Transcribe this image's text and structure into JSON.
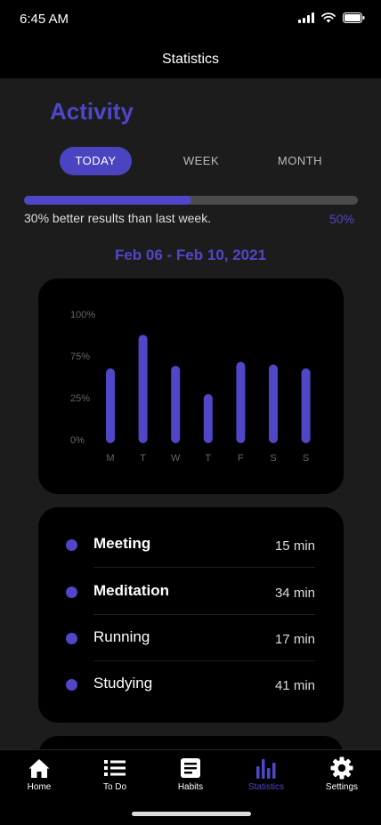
{
  "status_bar": {
    "time": "6:45 AM"
  },
  "header": {
    "title": "Statistics"
  },
  "activity": {
    "title": "Activity",
    "segments": [
      {
        "label": "TODAY",
        "active": true
      },
      {
        "label": "WEEK",
        "active": false
      },
      {
        "label": "MONTH",
        "active": false
      }
    ],
    "progress": {
      "fraction": 0.5,
      "value_label": "50%",
      "caption": "30% better results than last week."
    },
    "date_range": "Feb 06 - Feb 10, 2021"
  },
  "chart_data": {
    "type": "bar",
    "categories": [
      "M",
      "T",
      "W",
      "T",
      "F",
      "S",
      "S"
    ],
    "values": [
      58,
      84,
      60,
      38,
      63,
      61,
      58
    ],
    "yticks": [
      "100%",
      "75%",
      "25%",
      "0%"
    ],
    "ylim": [
      0,
      100
    ],
    "bar_color": "#5046c8",
    "grid": false
  },
  "activities": [
    {
      "name": "Meeting",
      "duration": "15 min",
      "bold": true
    },
    {
      "name": "Meditation",
      "duration": "34 min",
      "bold": true
    },
    {
      "name": "Running",
      "duration": "17 min",
      "bold": false
    },
    {
      "name": "Studying",
      "duration": "41 min",
      "bold": false
    }
  ],
  "tab_bar": {
    "items": [
      {
        "label": "Home",
        "icon": "home-icon",
        "active": false
      },
      {
        "label": "To Do",
        "icon": "list-icon",
        "active": false
      },
      {
        "label": "Habits",
        "icon": "notes-icon",
        "active": false
      },
      {
        "label": "Statistics",
        "icon": "bar-chart-icon",
        "active": true
      },
      {
        "label": "Settings",
        "icon": "gear-icon",
        "active": false
      }
    ]
  },
  "colors": {
    "accent": "#5046c8",
    "background": "#1c1c1c",
    "card": "#000000"
  }
}
